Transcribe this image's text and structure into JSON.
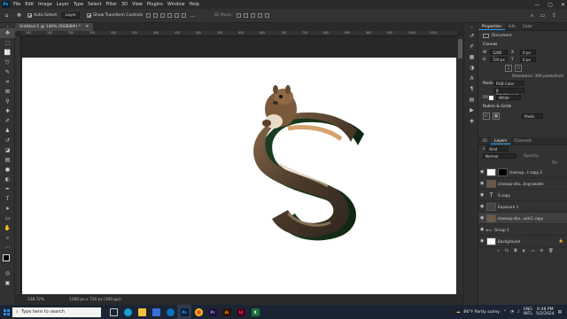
{
  "app": {
    "name": "Photoshop",
    "logo_text": "Ps"
  },
  "menu": [
    "File",
    "Edit",
    "Image",
    "Layer",
    "Type",
    "Select",
    "Filter",
    "3D",
    "View",
    "Plugins",
    "Window",
    "Help"
  ],
  "window_controls": {
    "minimize": "—",
    "maximize": "▢",
    "close": "✕"
  },
  "options_bar": {
    "auto_select_label": "Auto-Select:",
    "auto_select_value": "Layer",
    "show_transform_label": "Show Transform Controls",
    "mode_label": "3D Mode:"
  },
  "document": {
    "tab_label": "Untitled-1 @ 140% (RGB/8#) *",
    "ruler_ticks": [
      "100",
      "150",
      "200",
      "250",
      "300",
      "350",
      "400",
      "450",
      "500",
      "550",
      "600",
      "650",
      "700",
      "750",
      "800",
      "850",
      "900",
      "950",
      "1000",
      "1050"
    ],
    "zoom": "138.72%",
    "size_info": "1280 px x 720 px (300 ppi)"
  },
  "properties": {
    "tabs": [
      "Properties",
      "Info",
      "Color"
    ],
    "doc_label": "Document",
    "canvas_section": "Canvas",
    "w_label": "W",
    "w_value": "1280 px",
    "h_label": "H",
    "h_value": "720 px",
    "x_label": "X",
    "x_value": "0 px",
    "y_label": "Y",
    "y_value": "0 px",
    "resolution": "Resolution: 300 pixels/inch",
    "mode_label": "Mode",
    "mode_value": "RGB Color",
    "depth_value": "8 Bits/Channel",
    "fill_label": "Fill",
    "fill_value": "White",
    "rulers_section": "Rulers & Grids",
    "units_value": "Pixels"
  },
  "layers_panel": {
    "tabs": [
      "3D",
      "Layers",
      "Channels"
    ],
    "kind_label": "Kind",
    "blend_value": "Normal",
    "opacity_label": "Opacity:",
    "fill_label": "Fill:",
    "layers": [
      {
        "name": "closeup...t copy 2"
      },
      {
        "name": "closeup-sho...ling-pexels"
      },
      {
        "name": "S copy"
      },
      {
        "name": "Exposure 1"
      },
      {
        "name": "closeup-sho...xels1 copy"
      },
      {
        "name": "Group 1"
      },
      {
        "name": "Background"
      }
    ]
  },
  "taskbar": {
    "search_placeholder": "Type here to search",
    "weather": "86°F  Partly sunny",
    "lang": "ENG",
    "region": "INTL",
    "time": "6:48 PM",
    "date": "5/2/2024"
  }
}
